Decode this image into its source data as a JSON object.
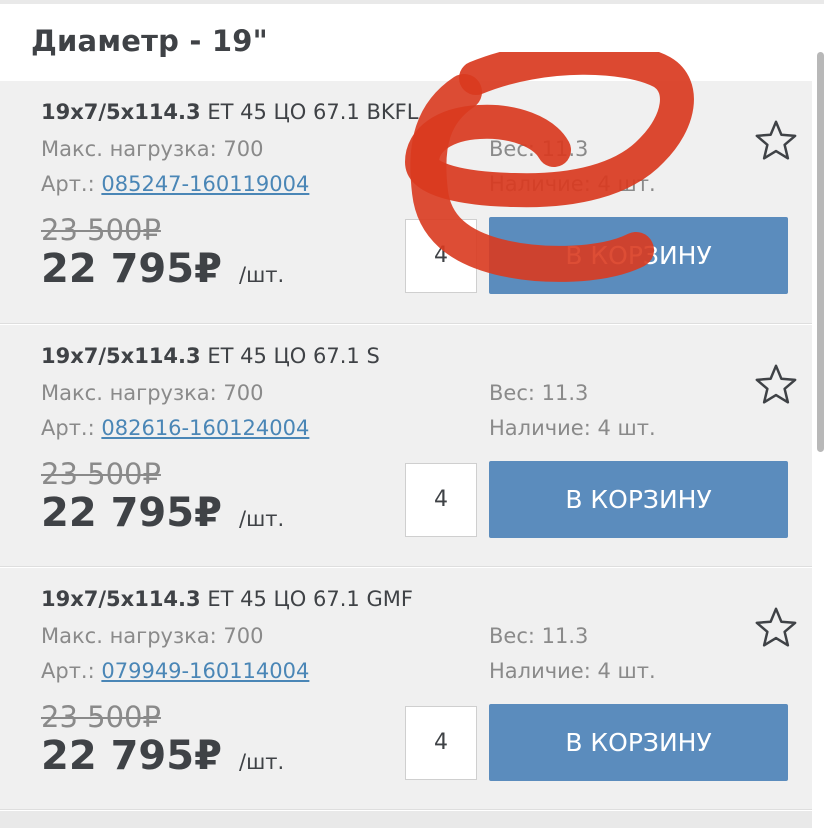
{
  "section": {
    "title": "Диаметр - 19\""
  },
  "products": [
    {
      "model": "19x7/5x114.3",
      "spec": "ET 45 ЦО 67.1 BKFL",
      "load": "Макс. нагрузка: 700",
      "art_label": "Арт.:",
      "art": "085247-160119004",
      "weight": "Вес: 11.3",
      "stock": "Наличие: 4 шт.",
      "old_price": "23 500₽",
      "price": "22 795₽",
      "unit": "/шт.",
      "qty": "4",
      "cart_label": "В КОРЗИНУ"
    },
    {
      "model": "19x7/5x114.3",
      "spec": "ET 45 ЦО 67.1 S",
      "load": "Макс. нагрузка: 700",
      "art_label": "Арт.:",
      "art": "082616-160124004",
      "weight": "Вес: 11.3",
      "stock": "Наличие: 4 шт.",
      "old_price": "23 500₽",
      "price": "22 795₽",
      "unit": "/шт.",
      "qty": "4",
      "cart_label": "В КОРЗИНУ"
    },
    {
      "model": "19x7/5x114.3",
      "spec": "ET 45 ЦО 67.1 GMF",
      "load": "Макс. нагрузка: 700",
      "art_label": "Арт.:",
      "art": "079949-160114004",
      "weight": "Вес: 11.3",
      "stock": "Наличие: 4 шт.",
      "old_price": "23 500₽",
      "price": "22 795₽",
      "unit": "/шт.",
      "qty": "4",
      "cart_label": "В КОРЗИНУ"
    }
  ],
  "icons": {
    "favorite": "star-outline-icon"
  },
  "colors": {
    "button": "#5b8cbd",
    "link": "#4a86b6",
    "annotation": "#d93a1f"
  }
}
